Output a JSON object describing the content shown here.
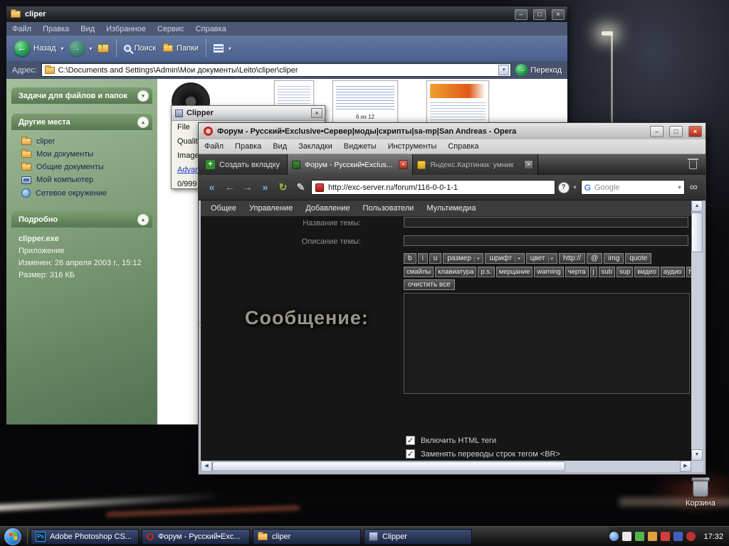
{
  "desktop": {
    "recycle_bin": "Корзина"
  },
  "explorer": {
    "title": "cliper",
    "menu": [
      "Файл",
      "Правка",
      "Вид",
      "Избранное",
      "Сервис",
      "Справка"
    ],
    "toolbar": {
      "back": "Назад",
      "search": "Поиск",
      "folders": "Папки"
    },
    "address": {
      "label": "Адрес:",
      "value": "C:\\Documents and Settings\\Admin\\Мои документы\\Leito\\cliper\\cliper",
      "go": "Переход"
    },
    "sidebar": {
      "tasks_title": "Задачи для файлов и папок",
      "places_title": "Другие места",
      "places": [
        "cliper",
        "Мои документы",
        "Общие документы",
        "Мой компьютер",
        "Сетевое окружение"
      ],
      "details_title": "Подробно",
      "details": {
        "name": "clipper.exe",
        "type": "Приложение",
        "modified": "Изменен: 26 апреля 2003 г., 15:12",
        "size": "Размер: 316 КБ"
      }
    },
    "main": {
      "thumb_caption": "6 из 12"
    }
  },
  "clipper_dialog": {
    "title": "Clipper",
    "menu_file": "File",
    "label_quality": "Quality",
    "label_image": "Image",
    "link_advanced": "Advanc",
    "counter": "0/999"
  },
  "opera": {
    "title": "Форум - Русский•Exclusive•Сервер|моды|скрипты|sa-mp|San Andreas - Opera",
    "menu": [
      "Файл",
      "Правка",
      "Вид",
      "Закладки",
      "Виджеты",
      "Инструменты",
      "Справка"
    ],
    "new_tab_label": "Создать вкладку",
    "tabs": [
      {
        "label": "Форум - Русский•Exclus..."
      },
      {
        "label": "Яндекс.Картинки: умник"
      }
    ],
    "address_value": "http://exc-server.ru/forum/116-0-0-1-1",
    "help_button": "?",
    "search_label": "Google",
    "forum": {
      "nav": [
        "Общее",
        "Управление",
        "Добавление",
        "Пользователи",
        "Мультимедиа"
      ],
      "title_label": "Название темы:",
      "desc_label": "Описание темы:",
      "bb_row1": [
        "b",
        "i",
        "u",
        "размер",
        "шрифт",
        "цвет",
        "http://",
        "@",
        "img",
        "quote"
      ],
      "bb_row2": [
        "смайлы",
        "клавиатура",
        "p.s.",
        "мерцание",
        "warning",
        "черта",
        "j",
        "sub",
        "sup",
        "видео",
        "аудио",
        "hr"
      ],
      "bb_clear": "очистить все",
      "message_label": "Сообщение:",
      "check_html": "Включить HTML теги",
      "check_br": "Заменять переводы строк тегом <BR>"
    }
  },
  "taskbar": {
    "buttons": [
      {
        "label": "Adobe Photoshop CS..."
      },
      {
        "label": "Форум - Русский•Exc..."
      },
      {
        "label": "cliper"
      },
      {
        "label": "Clipper"
      }
    ],
    "clock": "17:32"
  }
}
